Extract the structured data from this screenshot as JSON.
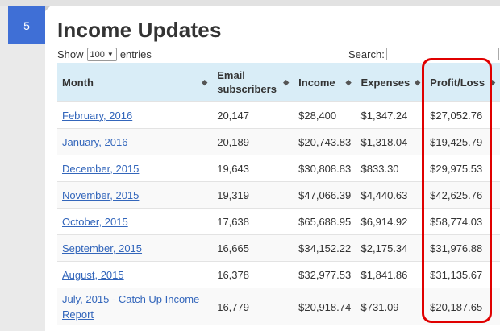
{
  "step": "5",
  "title": "Income Updates",
  "show": {
    "label": "Show",
    "value": "100",
    "suffix": "entries"
  },
  "search": {
    "label": "Search:",
    "value": ""
  },
  "columns": [
    "Month",
    "Email subscribers",
    "Income",
    "Expenses",
    "Profit/Loss"
  ],
  "rows": [
    {
      "month": "February, 2016",
      "email": "20,147",
      "income": "$28,400",
      "expenses": "$1,347.24",
      "pl": "$27,052.76"
    },
    {
      "month": "January, 2016",
      "email": "20,189",
      "income": "$20,743.83",
      "expenses": "$1,318.04",
      "pl": "$19,425.79"
    },
    {
      "month": "December, 2015",
      "email": "19,643",
      "income": "$30,808.83",
      "expenses": "$833.30",
      "pl": "$29,975.53"
    },
    {
      "month": "November, 2015",
      "email": "19,319",
      "income": "$47,066.39",
      "expenses": "$4,440.63",
      "pl": "$42,625.76"
    },
    {
      "month": "October, 2015",
      "email": "17,638",
      "income": "$65,688.95",
      "expenses": "$6,914.92",
      "pl": "$58,774.03"
    },
    {
      "month": "September, 2015",
      "email": "16,665",
      "income": "$34,152.22",
      "expenses": "$2,175.34",
      "pl": "$31,976.88"
    },
    {
      "month": "August, 2015",
      "email": "16,378",
      "income": "$32,977.53",
      "expenses": "$1,841.86",
      "pl": "$31,135.67"
    },
    {
      "month": "July, 2015 - Catch Up Income Report",
      "email": "16,779",
      "income": "$20,918.74",
      "expenses": "$731.09",
      "pl": "$20,187.65"
    }
  ],
  "highlight_color": "#e00000",
  "badge_color": "#3f6fd6",
  "header_bg": "#d9edf7",
  "link_color": "#3366bb"
}
